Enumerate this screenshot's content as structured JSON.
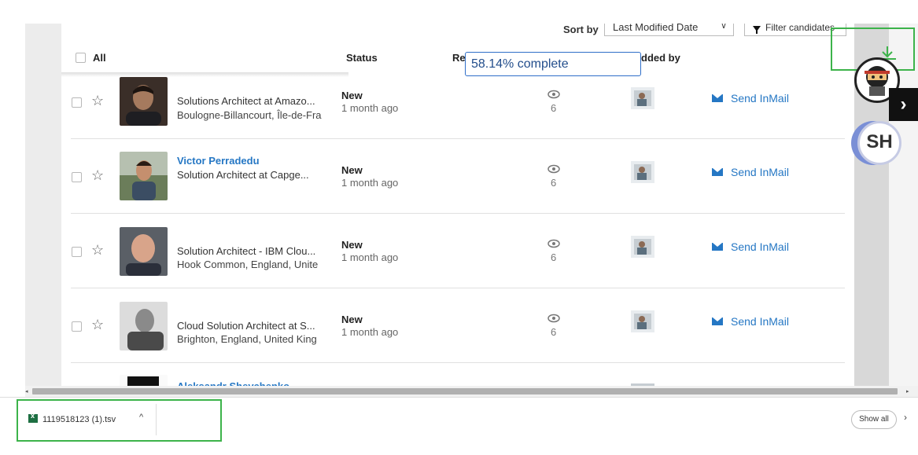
{
  "toolbar": {
    "sort_label": "Sort by",
    "sort_value": "Last Modified Date",
    "filter_label": "Filter candidates"
  },
  "header": {
    "all_label": "All",
    "status_label": "Status",
    "reviewed_label": "Re",
    "added_by_label": "dded by"
  },
  "progress": {
    "text": "58.14% complete",
    "percent": 58.14
  },
  "rows": [
    {
      "name": "",
      "title": "Solutions Architect at Amazo...",
      "location": "Boulogne-Billancourt, Île-de-Fra",
      "status": "New",
      "time": "1 month ago",
      "views": "6",
      "inmail": "Send InMail"
    },
    {
      "name": "Victor Perradedu",
      "title": "Solution Architect at Capge...",
      "location": "",
      "status": "New",
      "time": "1 month ago",
      "views": "6",
      "inmail": "Send InMail"
    },
    {
      "name": "",
      "title": "Solution Architect - IBM Clou...",
      "location": "Hook Common, England, Unite",
      "status": "New",
      "time": "1 month ago",
      "views": "6",
      "inmail": "Send InMail"
    },
    {
      "name": "",
      "title": "Cloud Solution Architect at S...",
      "location": "Brighton, England, United King",
      "status": "New",
      "time": "1 month ago",
      "views": "6",
      "inmail": "Send InMail"
    },
    {
      "name": "Aleksandr Shevchenko",
      "title": "",
      "location": "",
      "status": "",
      "time": "",
      "views": "",
      "inmail": ""
    }
  ],
  "extension": {
    "avatar_initials": "SH",
    "next_glyph": "›"
  },
  "downloads": {
    "filename": "1119518123 (1).tsv",
    "caret": "^",
    "show_all": "Show all",
    "close": "›"
  },
  "colors": {
    "link_blue": "#2577c4",
    "highlight_green": "#3cb34a",
    "progress_border": "#2e6ec8"
  }
}
